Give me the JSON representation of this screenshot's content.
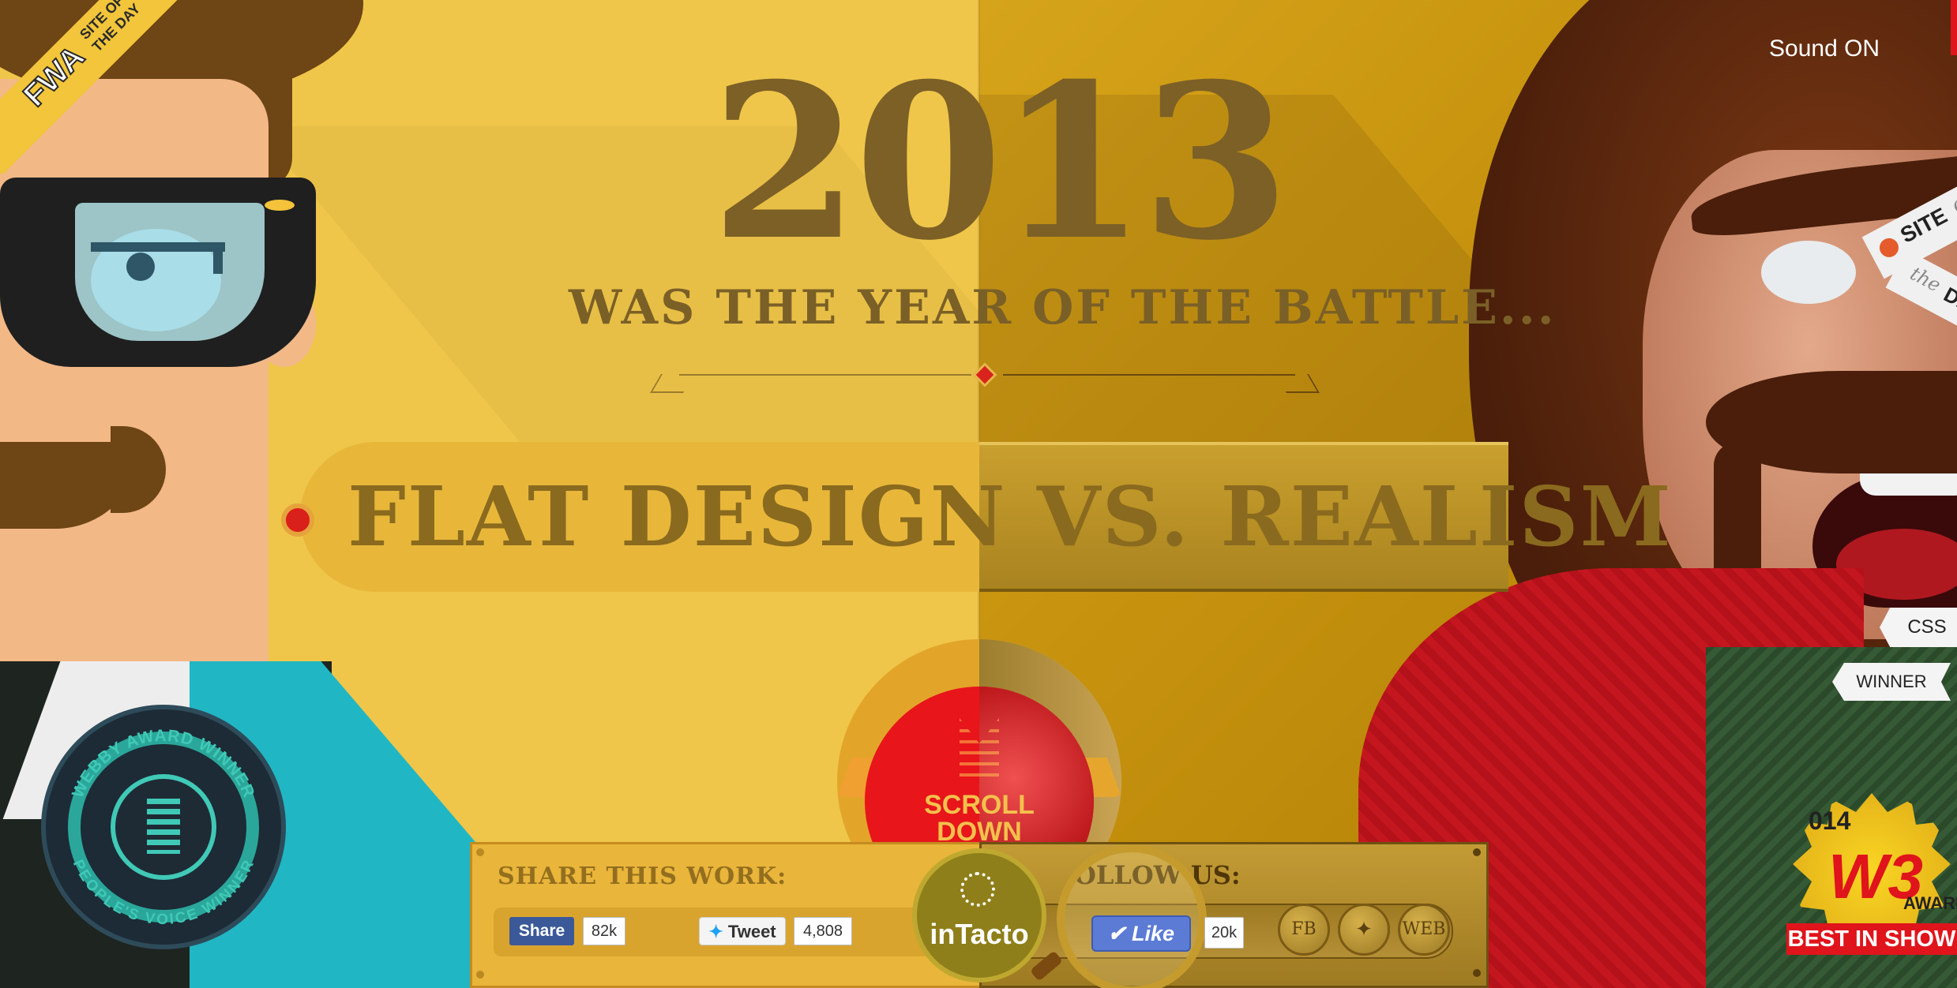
{
  "hero": {
    "year": "2013",
    "subtitle": "WAS THE YEAR OF THE BATTLE...",
    "headline": "FLAT DESIGN VS. REALISM"
  },
  "scroll_button": {
    "line1": "SCROLL",
    "line2": "DOWN"
  },
  "header": {
    "sound_label": "Sound ON"
  },
  "badges": {
    "fwa": {
      "brand": "FWA",
      "line1": "SITE OF",
      "line2": "THE DAY"
    },
    "site_of_the_day": {
      "line1": "SITE",
      "line1b": "of",
      "line2a": "the",
      "line2b": "DAY"
    },
    "css": "CSS",
    "winner": "WINNER",
    "webby": {
      "top": "WEBBY AWARD WINNER",
      "bottom": "PEOPLE'S VOICE WINNER"
    },
    "w3": {
      "year": "014",
      "brand": "W3",
      "awards": "AWARDS",
      "best": "BEST IN SHOW"
    }
  },
  "share": {
    "label": "SHARE THIS WORK:",
    "facebook_label": "Share",
    "facebook_count": "82k",
    "tweet_label": "Tweet",
    "tweet_count": "4,808"
  },
  "follow": {
    "label": "OLLOW US:",
    "like_label": "Like",
    "like_count": "20k",
    "buttons": [
      "FB",
      "",
      "WEB"
    ]
  },
  "studio": {
    "name": "inTacto"
  },
  "colors": {
    "flat_bg": "#EFC64A",
    "real_bg": "#C8940F",
    "red": "#E8151B",
    "facebook": "#3B5998"
  }
}
